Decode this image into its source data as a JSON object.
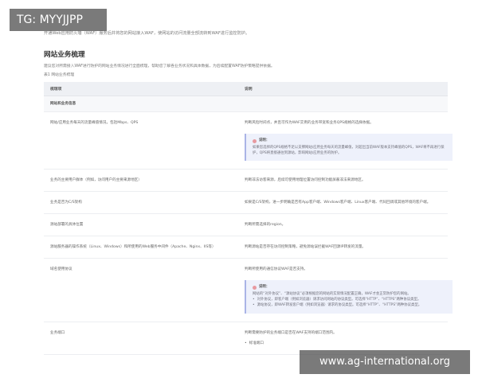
{
  "watermark_top": "TG: MYYJJPP",
  "watermark_bottom": "www.ag-international.org",
  "intro": "开通Web应用防火墙（WAF）服务后并将您的网站接入WAF，使网站的访问流量全部流转到WAF进行监控防护。",
  "section": {
    "title": "网站业务梳理",
    "desc": "建议您对所需接入WAF进行防护的网站业务情况进行全面梳理，帮助您了解各业务状况和具体数据，为后续配置WAF防护策略提供依据。",
    "table_caption": "表1 网站业务梳理"
  },
  "table": {
    "col1": "梳理项",
    "col2": "说明",
    "group": "网站和业务信息",
    "rows": [
      {
        "item": "网站/应用业务每天的流量峰值情况，包括Mbps、QPS",
        "desc": "判断风险时间点，并且可作为WAF实例的业务带宽和业务QPS规格的选择依据。",
        "note_title": "说明：",
        "note_text": "如果您选择的QPS规格不足以支撑网站/应用业务每天的流量峰值，对超出当前WAF版本支持峰值的QPS，WAF将不再进行保护，QPS将直接通往到源站，影响网站/应用业务的防护。"
      },
      {
        "item": "业务的主要用户群体（例如，访问用户的主要来源地区）",
        "desc": "判断非法访客来源，后续可使用地理位置访问控制功能屏蔽非法来源地区。"
      },
      {
        "item": "业务是否为C/S架构",
        "desc": "如果是C/S架构，进一步明确是否有App客户端、Windows客户端、Linux客户端、代码回调或其他环境的客户端。"
      },
      {
        "item": "源站部署的具体位置",
        "desc": "判断所需选择的region。"
      },
      {
        "item": "源站服务器的操作系统（Linux、Windows）和所使用的Web服务中间件（Apache、Nginx、IIS等）",
        "desc": "判断源站是否存在访问控制策略，避免源站误拦截WAF回源IP转发的流量。"
      },
      {
        "item": "域名使用协议",
        "desc": "判断所使用的通信协议WAF是否支持。",
        "note_title": "说明：",
        "note_text": "网站的“对外协议”、“源站协议”必须根据您的网站的实际情况配置正确，WAF才会正常防护您的网站。",
        "bullets": [
          "对外协议，即客户端（例如浏览器）请求访问网站的协议类型。可选择“HTTP”、“HTTPS”两种协议类型。",
          "源站协议，即WAF转发客户端（例如浏览器）请求的协议类型。可选择“HTTP”、“HTTPS”两种协议类型。"
        ]
      },
      {
        "item": "业务端口",
        "desc": "判断需要防护的业务端口是否在WAF支持的端口范围内。",
        "bullets": [
          "标准端口"
        ]
      }
    ]
  }
}
